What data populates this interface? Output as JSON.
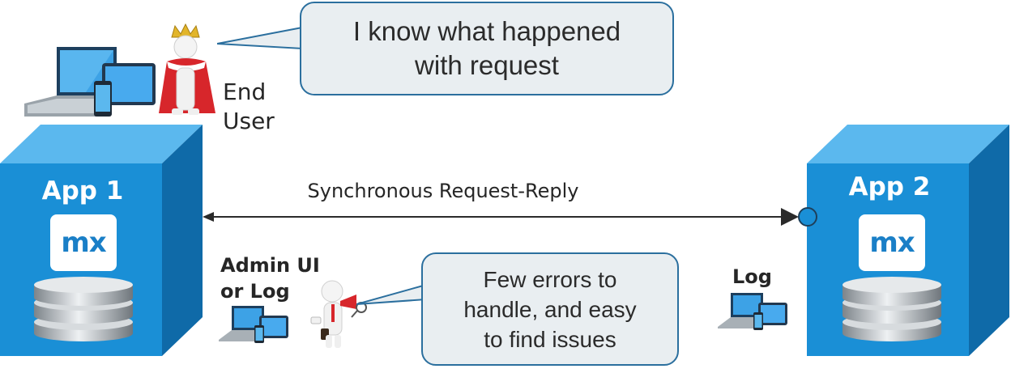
{
  "end_user": {
    "label_line1": "End",
    "label_line2": "User"
  },
  "top_bubble": {
    "text": "I know what happened\nwith request"
  },
  "arrow": {
    "label": "Synchronous Request-Reply"
  },
  "app1": {
    "title": "App 1",
    "logo": "mx"
  },
  "app2": {
    "title": "App 2",
    "logo": "mx"
  },
  "admin": {
    "label_line1": "Admin UI",
    "label_line2": "or Log"
  },
  "bottom_bubble": {
    "text": "Few errors to\nhandle, and easy\nto find issues"
  },
  "log": {
    "label": "Log"
  },
  "colors": {
    "cube_front": "#1a8fd6",
    "cube_top": "#5bb8ee",
    "cube_side": "#0f6aa8",
    "bubble_border": "#2b6f9e",
    "bubble_fill": "#e9eef1",
    "king_cape": "#d7262b"
  },
  "icons": [
    "devices-icon",
    "king-icon",
    "person-megaphone-icon",
    "database-icon",
    "port-circle-icon"
  ]
}
